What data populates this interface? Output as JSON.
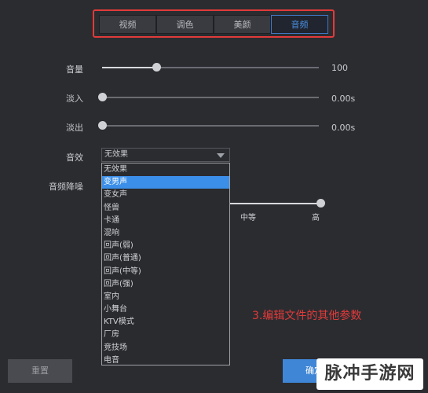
{
  "tabs": [
    "视频",
    "调色",
    "美颜",
    "音频"
  ],
  "active_tab": "音频",
  "sliders": {
    "volume": {
      "label": "音量",
      "value_text": "100",
      "level": 0.25
    },
    "fade_in": {
      "label": "淡入",
      "value_text": "0.00s",
      "level": 0.0
    },
    "fade_out": {
      "label": "淡出",
      "value_text": "0.00s",
      "level": 0.0
    }
  },
  "effect": {
    "label": "音效",
    "selected": "无效果",
    "options": [
      "无效果",
      "变男声",
      "变女声",
      "怪兽",
      "卡通",
      "混响",
      "回声(弱)",
      "回声(普通)",
      "回声(中等)",
      "回声(强)",
      "室内",
      "小舞台",
      "KTV模式",
      "厂房",
      "竞技场",
      "电音"
    ],
    "highlighted": "变男声"
  },
  "noise_reduction": {
    "label": "音频降噪",
    "ticks": [
      "中等",
      "高"
    ]
  },
  "annotation": "3.编辑文件的其他参数",
  "buttons": {
    "reset": "重置",
    "ok": "确定",
    "other": ""
  },
  "watermark": "脉冲手游网"
}
